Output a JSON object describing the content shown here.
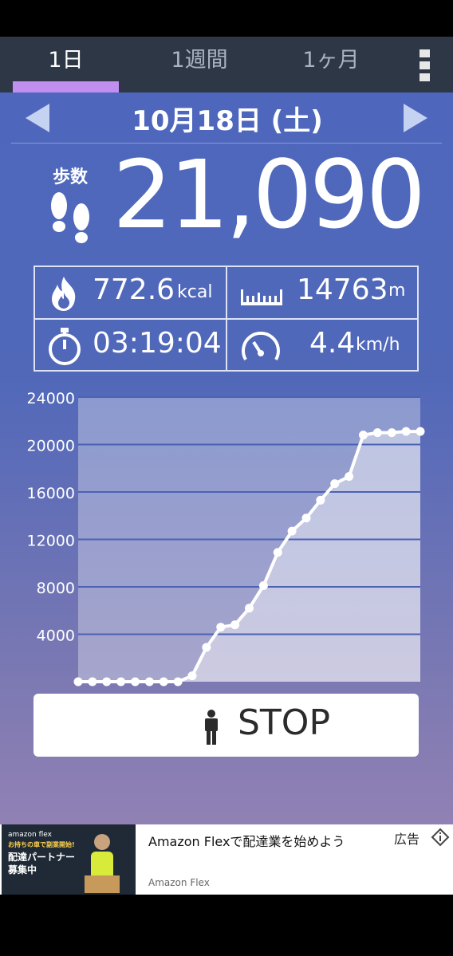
{
  "tabs": [
    {
      "label": "1日",
      "active": true
    },
    {
      "label": "1週間",
      "active": false
    },
    {
      "label": "1ヶ月",
      "active": false
    }
  ],
  "date": "10月18日 (土)",
  "steps": {
    "label": "歩数",
    "value": "21,090"
  },
  "stats": {
    "calories": {
      "value": "772.6",
      "unit": "kcal",
      "icon": "flame-icon"
    },
    "distance": {
      "value": "14763",
      "unit": "m",
      "icon": "ruler-icon"
    },
    "time": {
      "value": "03:19:04",
      "icon": "stopwatch-icon"
    },
    "speed": {
      "value": "4.4",
      "unit": "km/h",
      "icon": "speedometer-icon"
    }
  },
  "chart_data": {
    "type": "line",
    "ylim": [
      0,
      24000
    ],
    "xlim": [
      0,
      24
    ],
    "yticks": [
      "24000",
      "20000",
      "16000",
      "12000",
      "8000",
      "4000"
    ],
    "ytick_values": [
      24000,
      20000,
      16000,
      12000,
      8000,
      4000
    ],
    "xticks": [
      "2",
      "4",
      "6",
      "8",
      "10",
      "12",
      "14",
      "16",
      "18",
      "20",
      "22",
      "24"
    ],
    "xtick_values": [
      2,
      4,
      6,
      8,
      10,
      12,
      14,
      16,
      18,
      20,
      22,
      24
    ],
    "x": [
      0,
      1,
      2,
      3,
      4,
      5,
      6,
      7,
      8,
      9,
      10,
      11,
      12,
      13,
      14,
      15,
      16,
      17,
      18,
      19,
      20,
      21,
      22,
      23,
      24
    ],
    "y": [
      0,
      0,
      0,
      0,
      0,
      0,
      0,
      0,
      500,
      2900,
      4600,
      4800,
      6200,
      8100,
      10900,
      12700,
      13800,
      15300,
      16700,
      17300,
      20800,
      21000,
      21000,
      21100,
      21100
    ],
    "grid": true,
    "fill": true
  },
  "stop_button": {
    "label": "STOP"
  },
  "ad": {
    "image_brand": "amazon flex",
    "image_line1": "お持ちの車で副業開始!",
    "image_line2": "配達パートナー",
    "image_line3": "募集中",
    "title": "Amazon Flexで配達業を始めよう",
    "source": "Amazon Flex",
    "badge": "広告"
  }
}
